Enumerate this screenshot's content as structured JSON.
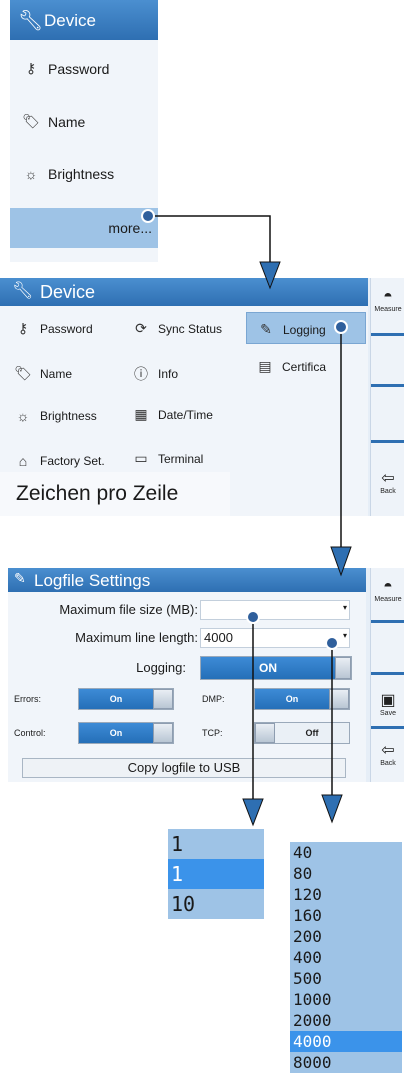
{
  "panel1": {
    "title": "Device",
    "items": [
      {
        "label": "Password",
        "icon": "key-icon"
      },
      {
        "label": "Name",
        "icon": "tag-icon"
      },
      {
        "label": "Brightness",
        "icon": "sun-icon"
      }
    ],
    "more_label": "more..."
  },
  "panel2": {
    "title": "Device",
    "col1": [
      "Password",
      "Name",
      "Brightness",
      "Factory Set."
    ],
    "col2": [
      "Sync Status",
      "Info",
      "Date/Time",
      "Terminal"
    ],
    "col3": [
      "Logging",
      "Certifica"
    ],
    "tooltip": "Zeichen pro Zeile",
    "side": {
      "measure": "Measure",
      "back": "Back"
    }
  },
  "panel3": {
    "title": "Logfile Settings",
    "max_file_label": "Maximum file size (MB):",
    "max_file_value": "",
    "max_line_label": "Maximum line length:",
    "max_line_value": "4000",
    "logging_label": "Logging:",
    "logging_state": "ON",
    "errors_label": "Errors:",
    "errors_state": "On",
    "dmp_label": "DMP:",
    "dmp_state": "On",
    "control_label": "Control:",
    "control_state": "On",
    "tcp_label": "TCP:",
    "tcp_state": "Off",
    "copy_button": "Copy logfile to USB",
    "side": {
      "measure": "Measure",
      "save": "Save",
      "back": "Back"
    }
  },
  "dropdown_file": {
    "options": [
      "1",
      "1",
      "10"
    ],
    "selected_index": 1
  },
  "dropdown_line": {
    "options": [
      "40",
      "80",
      "120",
      "160",
      "200",
      "400",
      "500",
      "1000",
      "2000",
      "4000",
      "8000"
    ],
    "selected_index": 9
  },
  "colors": {
    "header": "#2e6fb2",
    "accent": "#3b93ea",
    "panel": "#e6eef7",
    "dropdown": "#9ec3e6"
  }
}
